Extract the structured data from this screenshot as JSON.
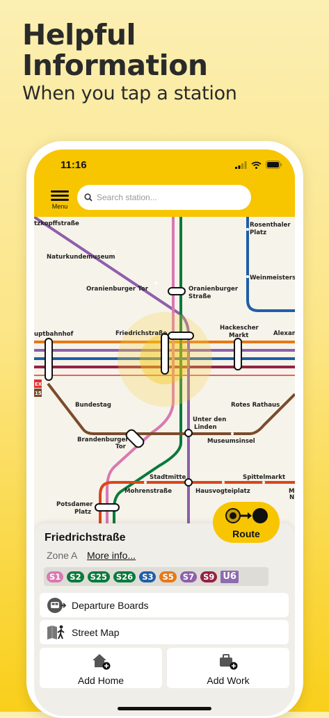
{
  "promo": {
    "title_line1": "Helpful",
    "title_line2": "Information",
    "subtitle": "When you tap a station"
  },
  "status_bar": {
    "time": "11:16"
  },
  "toolbar": {
    "menu_label": "Menu",
    "search_placeholder": "Search station..."
  },
  "map": {
    "labels": {
      "kopf": "tzkopffstraße",
      "naturkunde": "Naturkundemuseum",
      "oranienburger_tor": "Oranienburger Tor",
      "oranienburger_str_1": "Oranienburger",
      "oranienburger_str_2": "Straße",
      "rosenthaler_1": "Rosenthaler",
      "rosenthaler_2": "Platz",
      "weinmeister": "Weinmeisters",
      "hbf": "uptbahnhof",
      "friedrichstr": "Friedrichstraße",
      "hackescher_1": "Hackescher",
      "hackescher_2": "Markt",
      "alex": "Alexan",
      "bundestag": "Bundestag",
      "rotes_rathaus": "Rotes Rathaus",
      "unter_1": "Unter den",
      "unter_2": "Linden",
      "museumsinsel": "Museumsinsel",
      "brandenburger_1": "Brandenburger",
      "brandenburger_2": "Tor",
      "stadtmitte": "Stadtmitte",
      "spittelmarkt": "Spittelmarkt",
      "mohren": "Mohrenstraße",
      "hausvogtei": "Hausvogteiplatz",
      "potsdamer_1": "Potsdamer",
      "potsdamer_2": "Platz",
      "edge_m": "M",
      "edge_n": "N"
    },
    "badges": {
      "fex": "EX",
      "re5": "15"
    }
  },
  "colors": {
    "accent": "#f7c600",
    "s_violet": "#8d5fac",
    "s_pink": "#d978b1",
    "s_green": "#0a7a3c",
    "s_blue": "#1f5ea8",
    "s_orange": "#e77817",
    "s_darkred": "#962043",
    "u6": "#8c6cb0",
    "u_brown": "#7a4b2c",
    "u_red": "#d8461c"
  },
  "station_sheet": {
    "name": "Friedrichstraße",
    "zone": "Zone A",
    "more_info": "More info...",
    "lines": [
      {
        "label": "S1",
        "color": "#d978b1"
      },
      {
        "label": "S2",
        "color": "#0a7a3c"
      },
      {
        "label": "S25",
        "color": "#0a7a3c"
      },
      {
        "label": "S26",
        "color": "#0a7a3c"
      },
      {
        "label": "S3",
        "color": "#1f5ea8"
      },
      {
        "label": "S5",
        "color": "#e77817"
      },
      {
        "label": "S7",
        "color": "#8d5fac"
      },
      {
        "label": "S9",
        "color": "#962043"
      },
      {
        "label": "U6",
        "color": "#8c6cb0"
      }
    ],
    "route_label": "Route",
    "departure_label": "Departure Boards",
    "street_map_label": "Street Map",
    "add_home_label": "Add Home",
    "add_work_label": "Add Work"
  }
}
